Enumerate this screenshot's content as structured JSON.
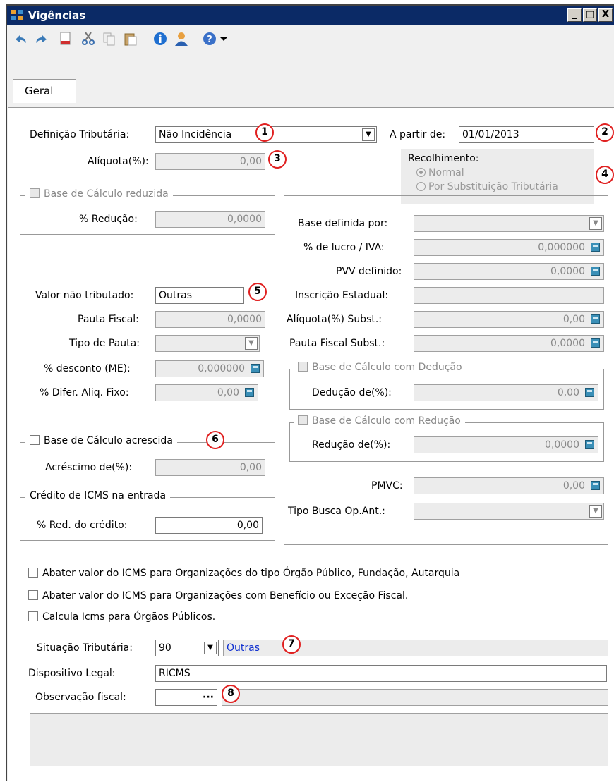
{
  "window": {
    "title": "Vigências",
    "minimize": "_",
    "maximize": "□",
    "close": "X"
  },
  "toolbar": [
    "undo-icon",
    "redo-icon",
    "new-doc-icon",
    "cut-icon",
    "copy-icon",
    "paste-icon",
    "info-icon",
    "user-icon",
    "help-icon",
    "dropdown-arrow-icon"
  ],
  "tabs": {
    "geral": "Geral"
  },
  "form": {
    "definicao_label": "Definição Tributária:",
    "definicao_value": "Não Incidência",
    "apartir_label": "A partir de:",
    "apartir_value": "01/01/2013",
    "aliquota_label": "Alíquota(%):",
    "aliquota_value": "0,00",
    "recolhimento_label": "Recolhimento:",
    "recolhimento_normal": "Normal",
    "recolhimento_subst": "Por Substituição Tributária",
    "base_reduzida_title": "Base de Cálculo reduzida",
    "reducao_label": "% Redução:",
    "reducao_value": "0,0000",
    "valor_nao_trib_label": "Valor não tributado:",
    "valor_nao_trib_value": "Outras",
    "pauta_fiscal_label": "Pauta Fiscal:",
    "pauta_fiscal_value": "0,0000",
    "tipo_pauta_label": "Tipo de Pauta:",
    "desconto_me_label": "% desconto (ME):",
    "desconto_me_value": "0,000000",
    "difer_aliq_label": "% Difer. Aliq. Fixo:",
    "difer_aliq_value": "0,00",
    "base_acrescida_title": "Base de Cálculo acrescida",
    "acrescimo_label": "Acréscimo de(%):",
    "acrescimo_value": "0,00",
    "credito_title": "Crédito de ICMS na entrada",
    "red_credito_label": "% Red. do crédito:",
    "red_credito_value": "0,00",
    "base_definida_label": "Base definida por:",
    "lucro_iva_label": "% de lucro / IVA:",
    "lucro_iva_value": "0,000000",
    "pvv_label": "PVV definido:",
    "pvv_value": "0,0000",
    "inscricao_label": "Inscrição Estadual:",
    "aliq_subst_label": "Alíquota(%) Subst.:",
    "aliq_subst_value": "0,00",
    "pauta_subst_label": "Pauta Fiscal Subst.:",
    "pauta_subst_value": "0,0000",
    "base_deducao_title": "Base de Cálculo com Dedução",
    "deducao_label": "Dedução de(%):",
    "deducao_value": "0,00",
    "base_reducao_title": "Base de Cálculo com Redução",
    "reducao2_label": "Redução de(%):",
    "reducao2_value": "0,0000",
    "pmvc_label": "PMVC:",
    "pmvc_value": "0,00",
    "tipo_busca_label": "Tipo Busca Op.Ant.:",
    "chk_abater_orgao": "Abater valor do ICMS para Organizações do tipo Órgão Público, Fundação, Autarquia",
    "chk_abater_beneficio": "Abater valor do ICMS para Organizações com Benefício ou Exceção Fiscal.",
    "chk_calcula_icms": "Calcula Icms para Órgãos Públicos.",
    "situacao_label": "Situação Tributária:",
    "situacao_code": "90",
    "situacao_desc": "Outras",
    "dispositivo_label": "Dispositivo Legal:",
    "dispositivo_value": "RICMS",
    "observacao_label": "Observação fiscal:",
    "observacao_btn": "···"
  },
  "badges": [
    "1",
    "2",
    "3",
    "4",
    "5",
    "6",
    "7",
    "8"
  ]
}
